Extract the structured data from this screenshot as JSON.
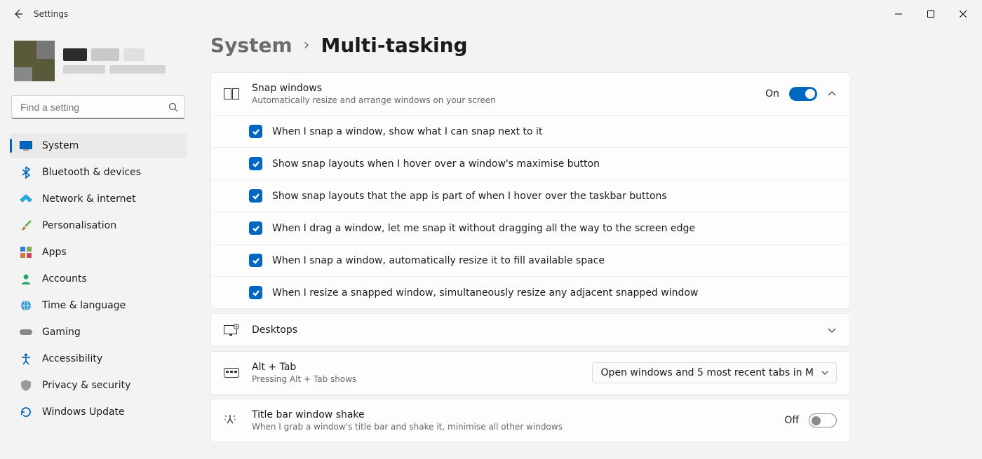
{
  "window": {
    "title": "Settings"
  },
  "search": {
    "placeholder": "Find a setting"
  },
  "nav": {
    "items": [
      {
        "label": "System"
      },
      {
        "label": "Bluetooth & devices"
      },
      {
        "label": "Network & internet"
      },
      {
        "label": "Personalisation"
      },
      {
        "label": "Apps"
      },
      {
        "label": "Accounts"
      },
      {
        "label": "Time & language"
      },
      {
        "label": "Gaming"
      },
      {
        "label": "Accessibility"
      },
      {
        "label": "Privacy & security"
      },
      {
        "label": "Windows Update"
      }
    ]
  },
  "breadcrumb": {
    "parent": "System",
    "current": "Multi-tasking"
  },
  "snap": {
    "title": "Snap windows",
    "desc": "Automatically resize and arrange windows on your screen",
    "state": "On",
    "options": [
      "When I snap a window, show what I can snap next to it",
      "Show snap layouts when I hover over a window's maximise button",
      "Show snap layouts that the app is part of when I hover over the taskbar buttons",
      "When I drag a window, let me snap it without dragging all the way to the screen edge",
      "When I snap a window, automatically resize it to fill available space",
      "When I resize a snapped window, simultaneously resize any adjacent snapped window"
    ]
  },
  "desktops": {
    "title": "Desktops"
  },
  "alttab": {
    "title": "Alt + Tab",
    "desc": "Pressing Alt + Tab shows",
    "selected": "Open windows and 5 most recent tabs in M"
  },
  "shake": {
    "title": "Title bar window shake",
    "desc": "When I grab a window's title bar and shake it, minimise all other windows",
    "state": "Off"
  }
}
